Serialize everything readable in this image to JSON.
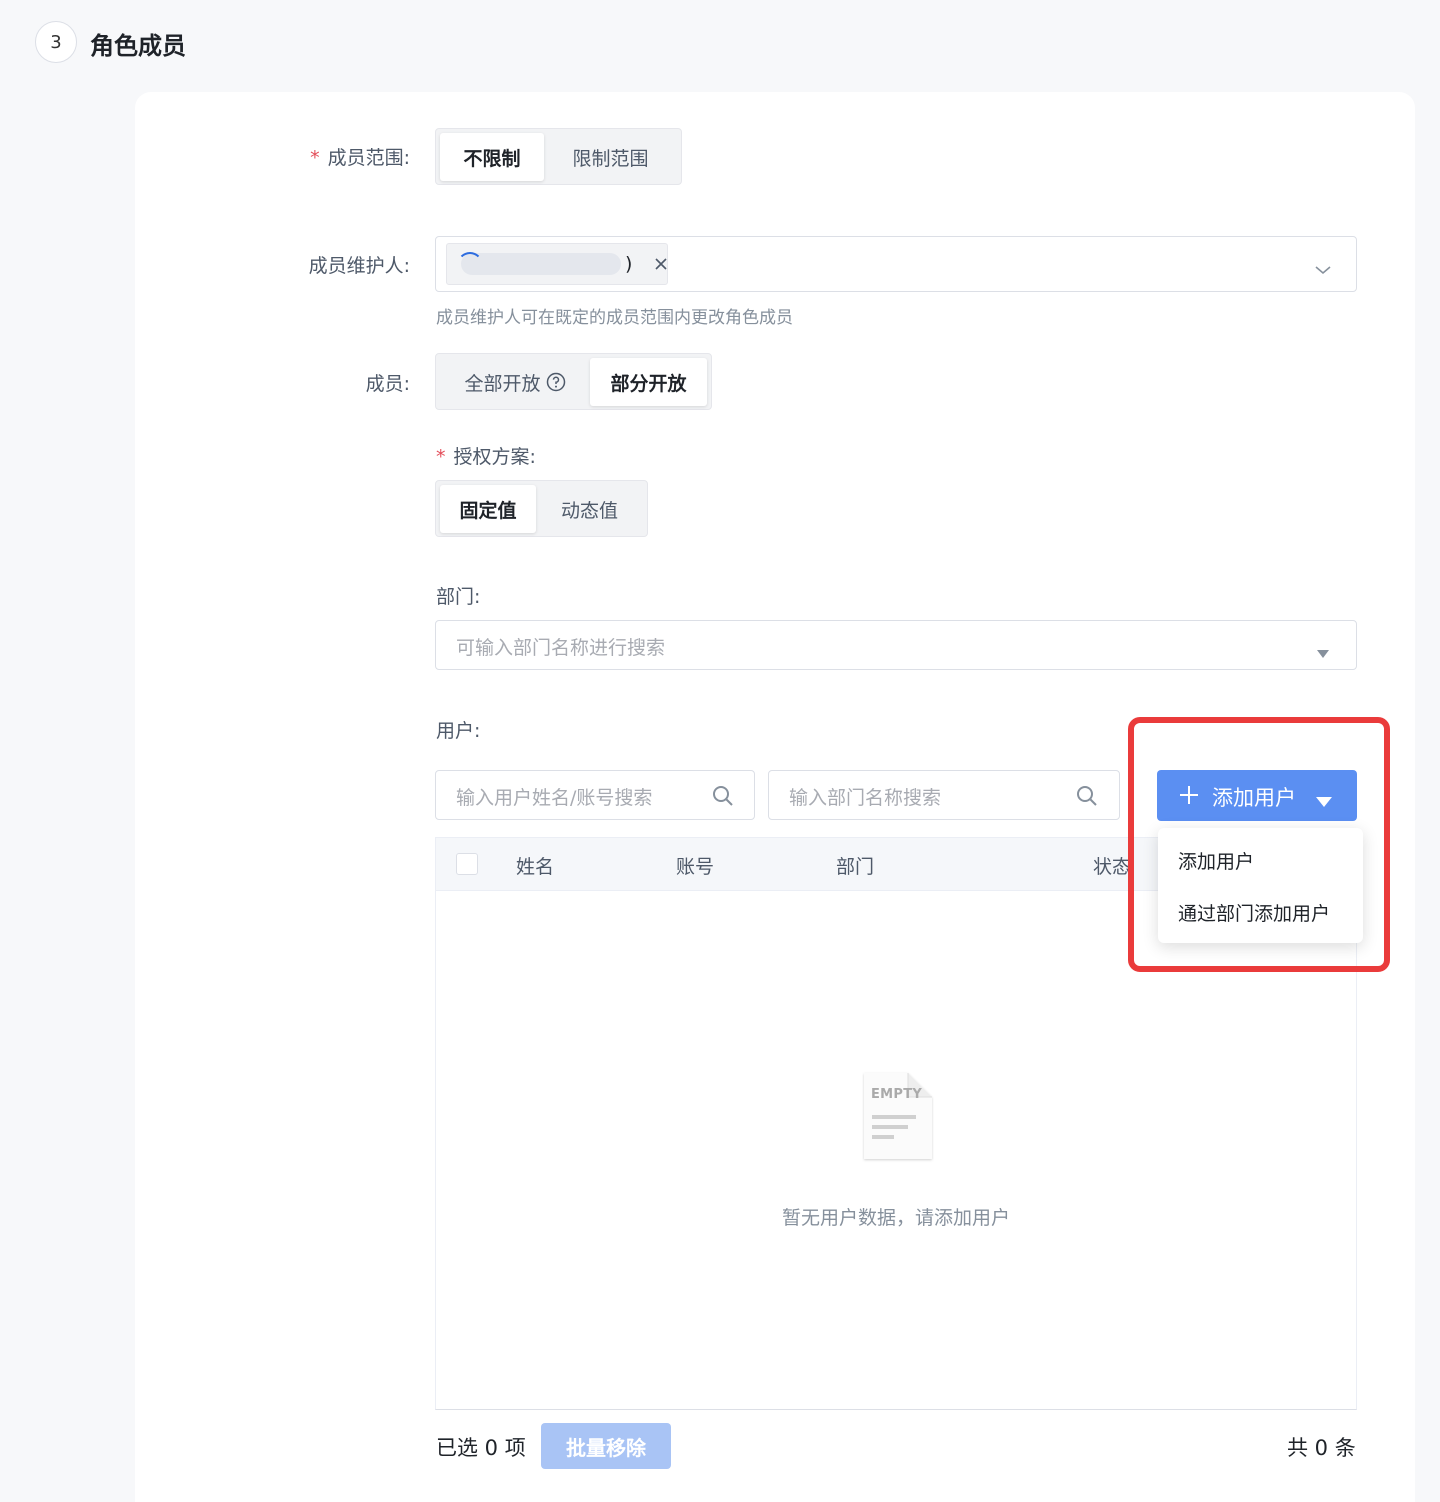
{
  "section": {
    "step_number": "3",
    "title": "角色成员"
  },
  "member_scope": {
    "label": "成员范围:",
    "required_mark": "*",
    "options": [
      "不限制",
      "限制范围"
    ],
    "selected": "不限制"
  },
  "member_maintainer": {
    "label": "成员维护人:",
    "tag_text": ")",
    "hint": "成员维护人可在既定的成员范围内更改角色成员"
  },
  "members": {
    "label": "成员:",
    "options": [
      "全部开放",
      "部分开放"
    ],
    "selected": "部分开放"
  },
  "auth_scheme": {
    "label": "授权方案:",
    "required_mark": "*",
    "options": [
      "固定值",
      "动态值"
    ],
    "selected": "固定值"
  },
  "department": {
    "label": "部门:",
    "placeholder": "可输入部门名称进行搜索"
  },
  "users": {
    "label": "用户:",
    "search_user_placeholder": "输入用户姓名/账号搜索",
    "search_dept_placeholder": "输入部门名称搜索",
    "add_button": "添加用户",
    "dropdown_items": [
      "添加用户",
      "通过部门添加用户"
    ],
    "table_columns": [
      "姓名",
      "账号",
      "部门",
      "状态"
    ],
    "empty_image_text": "EMPTY",
    "empty_text": "暂无用户数据，请添加用户"
  },
  "footer": {
    "selected_text": "已选 0 项",
    "batch_remove": "批量移除",
    "total_text": "共 0 条"
  },
  "colors": {
    "primary": "#5b8ff2",
    "primary_disabled": "#a9c4f5",
    "required": "#e34d59",
    "highlight_box": "#ea3b3b"
  }
}
